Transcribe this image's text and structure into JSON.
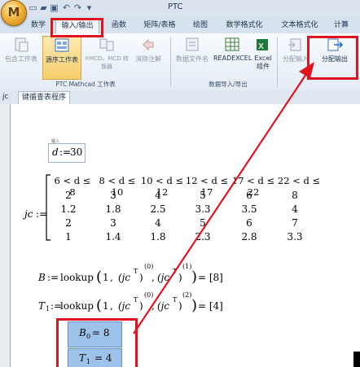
{
  "app": {
    "logo_letter": "M",
    "title": "PTC"
  },
  "quick_access": [
    {
      "name": "new-file-icon",
      "glyph": "▭"
    },
    {
      "name": "open-folder-icon",
      "glyph": "▰"
    },
    {
      "name": "save-icon",
      "glyph": "▣"
    },
    {
      "name": "undo-icon",
      "glyph": "↶"
    },
    {
      "name": "redo-icon",
      "glyph": "↷"
    },
    {
      "name": "dropdown-icon",
      "glyph": "▾"
    }
  ],
  "tabs": [
    "数学",
    "输入/输出",
    "函数",
    "矩阵/表格",
    "绘图",
    "数学格式化",
    "文本格式化",
    "计算"
  ],
  "active_tab": "输入/输出",
  "ribbon": {
    "buttons": {
      "include_worksheet": "包含工作表",
      "worksheet_on": "源序工作表",
      "xmcd_converter": "XMCD、MCD 转换器",
      "clear_comments": "消除注解",
      "data_file_name": "数据文件名",
      "readexcel": "READEXCEL",
      "excel_component": "Excel 组件",
      "assign_input": "分配输入",
      "assign_output": "分配输出"
    },
    "groups": {
      "worksheet": "PTC Mathcad 工作表",
      "data_io": "数据导入/导出"
    }
  },
  "doc_tabs": {
    "short": "jc",
    "main": "键循查表程序"
  },
  "worksheet": {
    "input_label": "输入",
    "d_def": {
      "var": "d",
      "op": ":=",
      "value": "30"
    },
    "jc_def": {
      "var": "jc",
      "op": ":="
    },
    "jc_matrix": [
      [
        "6 < d ≤ 8",
        "8 < d ≤ 10",
        "10 < d ≤ 12",
        "12 < d ≤ 17",
        "17 < d ≤ 22",
        "22 < d ≤"
      ],
      [
        "2",
        "3",
        "4",
        "5",
        "6",
        "8"
      ],
      [
        "1.2",
        "1.8",
        "2.5",
        "3.3",
        "3.5",
        "4"
      ],
      [
        "2",
        "3",
        "4",
        "5",
        "6",
        "7"
      ],
      [
        "1",
        "1.4",
        "1.8",
        "2.3",
        "2.8",
        "3.3"
      ]
    ],
    "b_eq": {
      "lhs": "B",
      "op": ":=",
      "fn": "lookup",
      "arg1": "1",
      "arg2": "jc",
      "sup2": "T",
      "col2": "(0)",
      "arg3": "jc",
      "sup3": "T",
      "col3": "(1)",
      "result": "= [8]"
    },
    "t1_eq": {
      "lhs": "T",
      "lhs_sub": "1",
      "op": ":=",
      "fn": "lookup",
      "arg1": "1",
      "arg2": "jc",
      "sup2": "T",
      "col2": "(0)",
      "arg3": "jc",
      "sup3": "T",
      "col3": "(2)",
      "result": "= [4]"
    },
    "outputs": [
      {
        "var": "B",
        "sub": "0",
        "value": "= 8"
      },
      {
        "var": "T",
        "sub": "1",
        "value": "= 4"
      }
    ]
  },
  "annotation_color": "#e0141e"
}
